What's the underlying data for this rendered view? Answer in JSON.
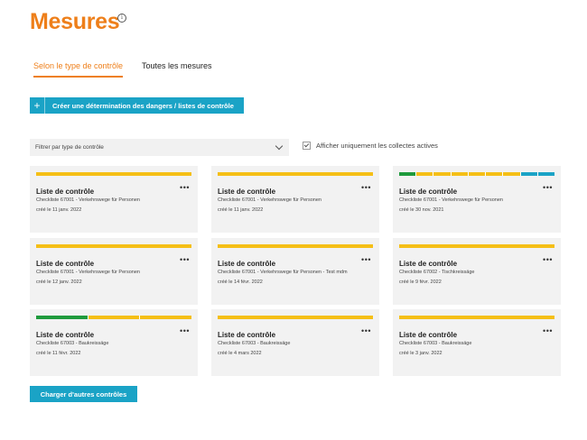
{
  "page": {
    "title": "Mesures",
    "info_icon": "i"
  },
  "tabs": [
    {
      "label": "Selon le type de contrôle",
      "active": true
    },
    {
      "label": "Toutes les mesures",
      "active": false
    }
  ],
  "create_button": {
    "icon": "+",
    "label": "Créer une détermination des dangers / listes de contrôle"
  },
  "filter": {
    "placeholder": "Filtrer par type de contrôle",
    "checkbox_label": "Afficher uniquement les collectes actives",
    "checked": true
  },
  "colors": {
    "accent": "#ee7f1a",
    "primary": "#1aa3c6",
    "yellow": "#f5bf16",
    "green": "#1e9a3c",
    "blue": "#1aa3c6"
  },
  "cards": [
    {
      "title": "Liste de contrôle",
      "subtitle": "Checkliste 67001 - Verkehrswege für Personen",
      "date": "créé le 11 janv. 2022",
      "segments": [
        "yellow"
      ]
    },
    {
      "title": "Liste de contrôle",
      "subtitle": "Checkliste 67001 - Verkehrswege für Personen",
      "date": "créé le 11 janv. 2022",
      "segments": [
        "yellow"
      ]
    },
    {
      "title": "Liste de contrôle",
      "subtitle": "Checkliste 67001 - Verkehrswege für Personen",
      "date": "créé le 30 nov. 2021",
      "segments": [
        "green",
        "yellow",
        "yellow",
        "yellow",
        "yellow",
        "yellow",
        "yellow",
        "blue",
        "blue"
      ]
    },
    {
      "title": "Liste de contrôle",
      "subtitle": "Checkliste 67001 - Verkehrswege für Personen",
      "date": "créé le 12 janv. 2022",
      "segments": [
        "yellow"
      ]
    },
    {
      "title": "Liste de contrôle",
      "subtitle": "Checkliste 67001 - Verkehrswege für Personen - Test mdm",
      "date": "créé le 14 févr. 2022",
      "segments": [
        "yellow"
      ]
    },
    {
      "title": "Liste de contrôle",
      "subtitle": "Checkliste 67002 - Tischkreissäge",
      "date": "créé le 9 févr. 2022",
      "segments": [
        "yellow"
      ]
    },
    {
      "title": "Liste de contrôle",
      "subtitle": "Checkliste 67003 - Baukreissäge",
      "date": "créé le 11 févr. 2022",
      "segments": [
        "green",
        "yellow",
        "yellow"
      ]
    },
    {
      "title": "Liste de contrôle",
      "subtitle": "Checkliste 67003 - Baukreissäge",
      "date": "créé le 4 mars 2022",
      "segments": [
        "yellow"
      ]
    },
    {
      "title": "Liste de contrôle",
      "subtitle": "Checkliste 67003 - Baukreissäge",
      "date": "créé le 3 janv. 2022",
      "segments": [
        "yellow"
      ]
    }
  ],
  "card_menu_icon": "•••",
  "load_more_button": "Charger d'autres contrôles"
}
